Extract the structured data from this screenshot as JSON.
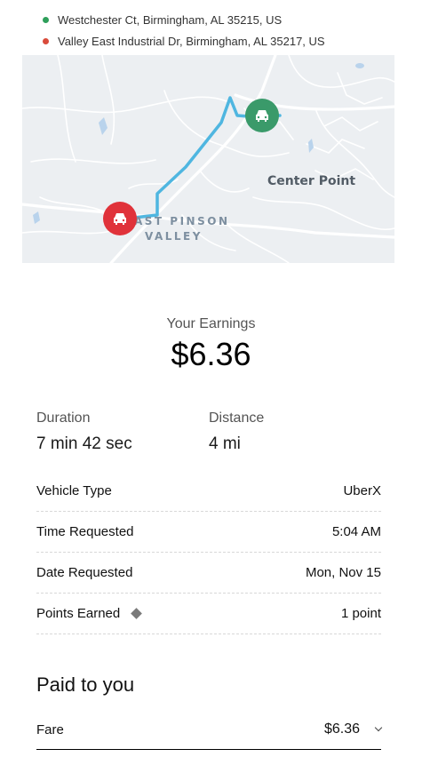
{
  "trip": {
    "pickup_address": "Westchester Ct, Birmingham, AL 35215, US",
    "dropoff_address": "Valley East Industrial Dr, Birmingham, AL 35217, US",
    "pickup_color": "#2e9f5a",
    "dropoff_color": "#d94b3b"
  },
  "map": {
    "labels": {
      "area1": "Center Point",
      "area2_line1": "AST PINSON",
      "area2_line2": "VALLEY"
    },
    "pickup_marker_icon": "car-icon",
    "dropoff_marker_icon": "car-icon",
    "route_color": "#4fb6e0",
    "pickup_marker_color": "#3a9a6a",
    "dropoff_marker_color": "#e0323a"
  },
  "earnings": {
    "label": "Your Earnings",
    "value": "$6.36"
  },
  "stats": {
    "duration_label": "Duration",
    "duration_value": "7 min 42 sec",
    "distance_label": "Distance",
    "distance_value": "4 mi"
  },
  "details": [
    {
      "label": "Vehicle Type",
      "value": "UberX"
    },
    {
      "label": "Time Requested",
      "value": "5:04 AM"
    },
    {
      "label": "Date Requested",
      "value": "Mon, Nov 15"
    },
    {
      "label": "Points Earned",
      "value": "1 point",
      "icon": "diamond-icon"
    }
  ],
  "paid": {
    "title": "Paid to you",
    "fare_label": "Fare",
    "fare_value": "$6.36"
  }
}
